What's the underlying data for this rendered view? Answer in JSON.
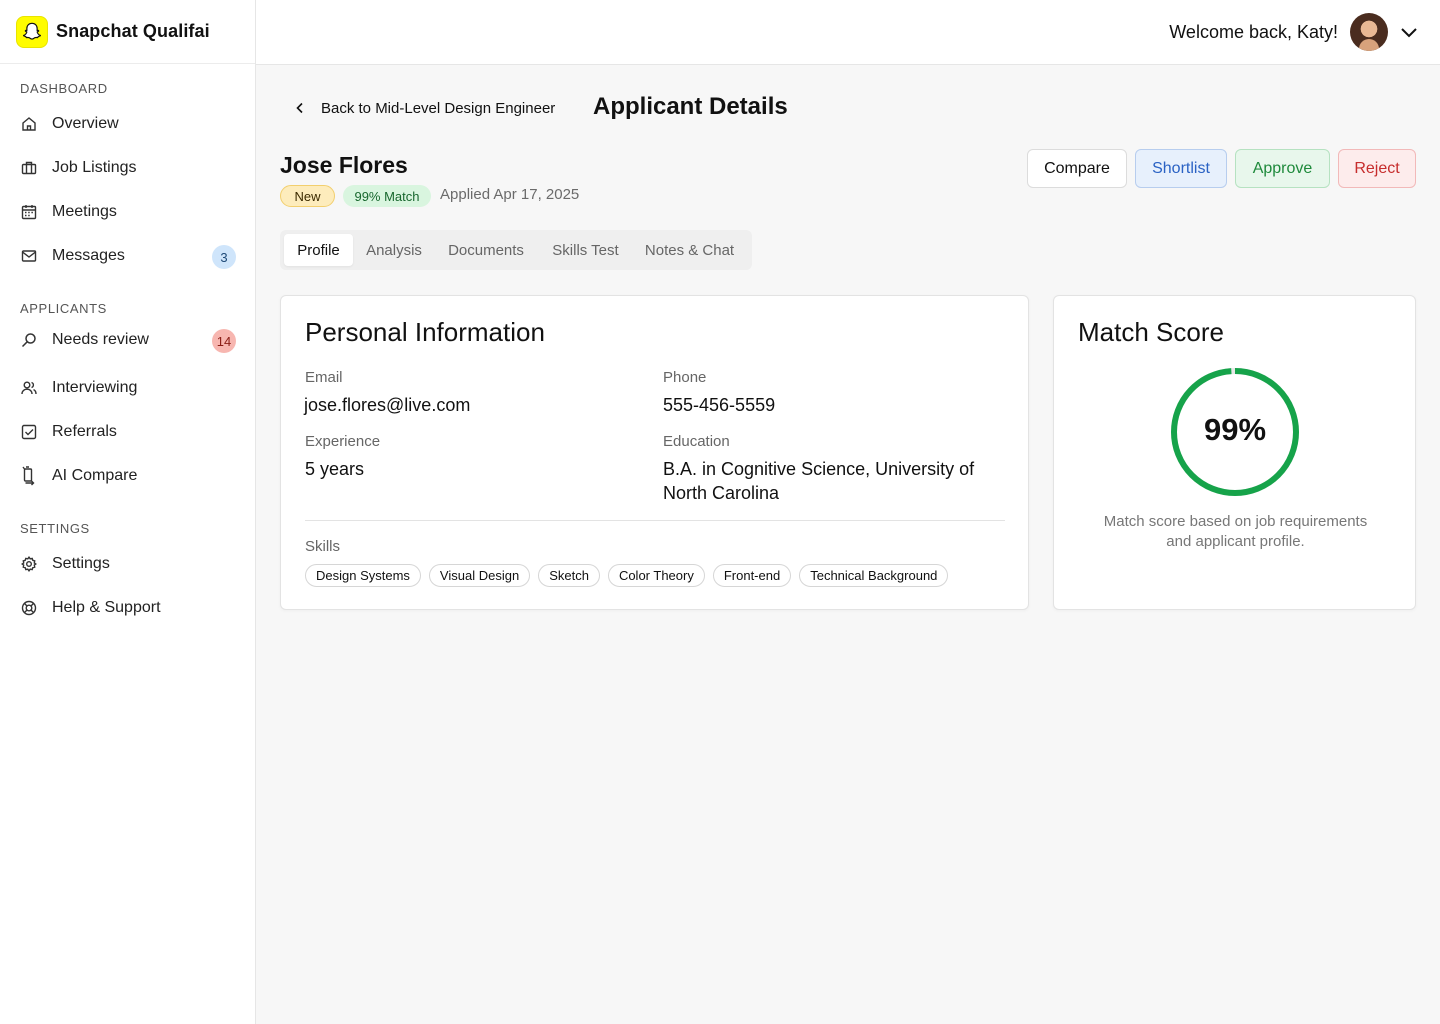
{
  "brand": {
    "name": "Snapchat Qualifai"
  },
  "sidebar": {
    "sections": [
      {
        "label": "DASHBOARD"
      },
      {
        "label": "APPLICANTS"
      },
      {
        "label": "SETTINGS"
      }
    ],
    "items": [
      {
        "label": "Overview",
        "icon": "home-icon"
      },
      {
        "label": "Job Listings",
        "icon": "briefcase-icon"
      },
      {
        "label": "Meetings",
        "icon": "calendar-icon"
      },
      {
        "label": "Messages",
        "icon": "mail-icon",
        "badge": "3"
      },
      {
        "label": "Needs review",
        "icon": "search-icon",
        "badge": "14"
      },
      {
        "label": "Interviewing",
        "icon": "users-icon"
      },
      {
        "label": "Referrals",
        "icon": "checkbox-icon"
      },
      {
        "label": "AI Compare",
        "icon": "compare-icon"
      },
      {
        "label": "Settings",
        "icon": "gear-icon"
      },
      {
        "label": "Help & Support",
        "icon": "lifebuoy-icon"
      }
    ]
  },
  "header": {
    "welcome": "Welcome back, Katy!"
  },
  "page": {
    "back_label": "Back to Mid-Level Design Engineer",
    "title": "Applicant Details"
  },
  "applicant": {
    "name": "Jose Flores",
    "status_badge": "New",
    "match_badge": "99% Match",
    "applied": "Applied Apr  17, 2025"
  },
  "actions": {
    "compare": "Compare",
    "shortlist": "Shortlist",
    "approve": "Approve",
    "reject": "Reject"
  },
  "tabs": [
    {
      "label": "Profile",
      "active": true
    },
    {
      "label": "Analysis"
    },
    {
      "label": "Documents"
    },
    {
      "label": "Skills Test"
    },
    {
      "label": "Notes & Chat"
    }
  ],
  "personal": {
    "title": "Personal Information",
    "email_label": "Email",
    "email": "jose.flores@live.com",
    "phone_label": "Phone",
    "phone": "555-456-5559",
    "experience_label": "Experience",
    "experience": "5 years",
    "education_label": "Education",
    "education_line1": "B.A. in Cognitive Science, University of",
    "education_line2": "North Carolina",
    "skills_label": "Skills",
    "skills": [
      "Design Systems",
      "Visual Design",
      "Sketch",
      "Color Theory",
      "Front-end",
      "Technical Background"
    ]
  },
  "match": {
    "title": "Match Score",
    "value": "99%",
    "score_fraction": 0.99,
    "caption": "Match score based on job requirements and applicant profile."
  },
  "colors": {
    "brand_yellow": "#fffc00",
    "gauge_green": "#16a34a",
    "shortlist_blue": "#2a62c4",
    "approve_green": "#1e8a3b",
    "reject_red": "#c62d2d"
  }
}
